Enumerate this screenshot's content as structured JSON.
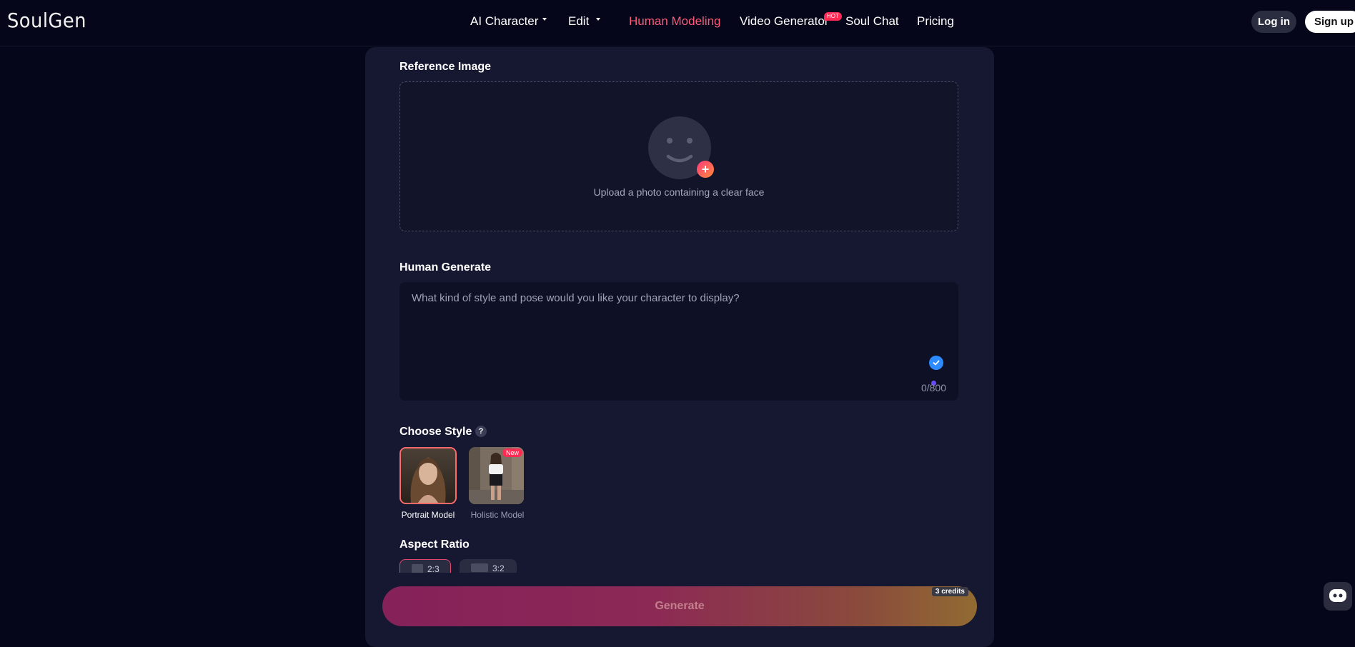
{
  "header": {
    "logo": "SoulGen",
    "nav": [
      {
        "label": "AI Character",
        "dropdown": true
      },
      {
        "label": "Edit",
        "dropdown": true
      },
      {
        "label": "Human Modeling",
        "active": true
      },
      {
        "label": "Video Generator",
        "badge": "HOT"
      },
      {
        "label": "Soul Chat"
      },
      {
        "label": "Pricing"
      }
    ],
    "login_label": "Log in",
    "signup_label": "Sign up"
  },
  "reference": {
    "title": "Reference Image",
    "upload_text": "Upload a photo containing a clear face",
    "icon": "smiley-face-icon"
  },
  "generate_section": {
    "title": "Human Generate",
    "placeholder": "What kind of style and pose would you like your character to display?",
    "counter": "0/800"
  },
  "style": {
    "title": "Choose Style",
    "help": "?",
    "options": [
      {
        "label": "Portrait Model",
        "selected": true
      },
      {
        "label": "Holistic Model",
        "badge": "New"
      }
    ]
  },
  "aspect": {
    "title": "Aspect Ratio",
    "options": [
      {
        "label": "2:3",
        "selected": true
      },
      {
        "label": "3:2"
      }
    ]
  },
  "generate_button": {
    "label": "Generate",
    "credits": "3 credits"
  },
  "colors": {
    "background": "#05061a",
    "panel": "#161831",
    "accent": "#ff5a78"
  }
}
